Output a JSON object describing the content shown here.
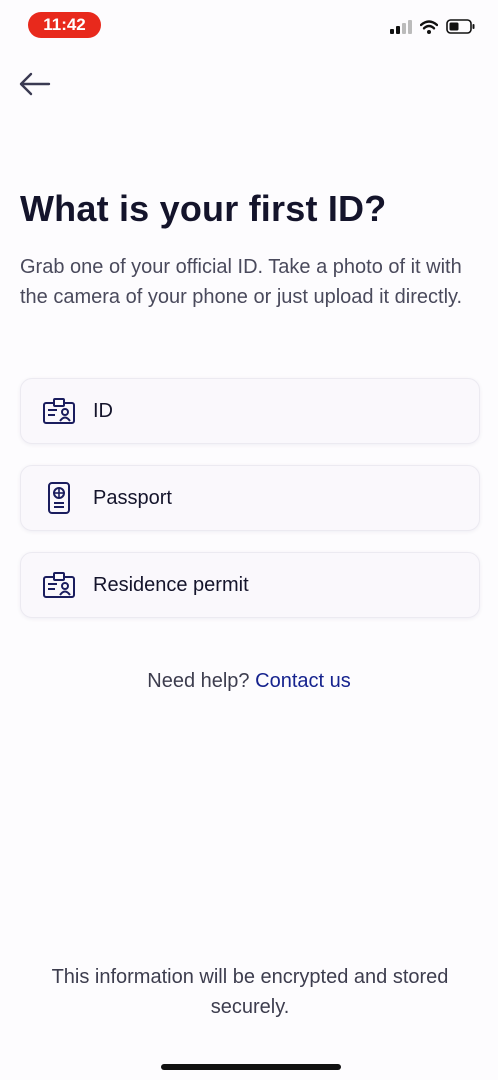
{
  "status_bar": {
    "time": "11:42",
    "icons": [
      "signal-icon",
      "wifi-icon",
      "battery-icon"
    ]
  },
  "header": {
    "back_icon": "arrow-left-icon"
  },
  "main": {
    "title": "What is your first ID?",
    "subtitle": "Grab one of your official ID. Take a photo of it with the camera of your phone or just upload it directly.",
    "options": [
      {
        "label": "ID",
        "icon": "id-card-icon"
      },
      {
        "label": "Passport",
        "icon": "passport-icon"
      },
      {
        "label": "Residence permit",
        "icon": "id-card-icon"
      }
    ]
  },
  "help": {
    "prefix": "Need help?",
    "link": "Contact us"
  },
  "footer": {
    "text": "This information will be encrypted and stored securely."
  },
  "colors": {
    "accent": "#16238e",
    "time_pill": "#e8291c",
    "text_primary": "#14142b"
  }
}
